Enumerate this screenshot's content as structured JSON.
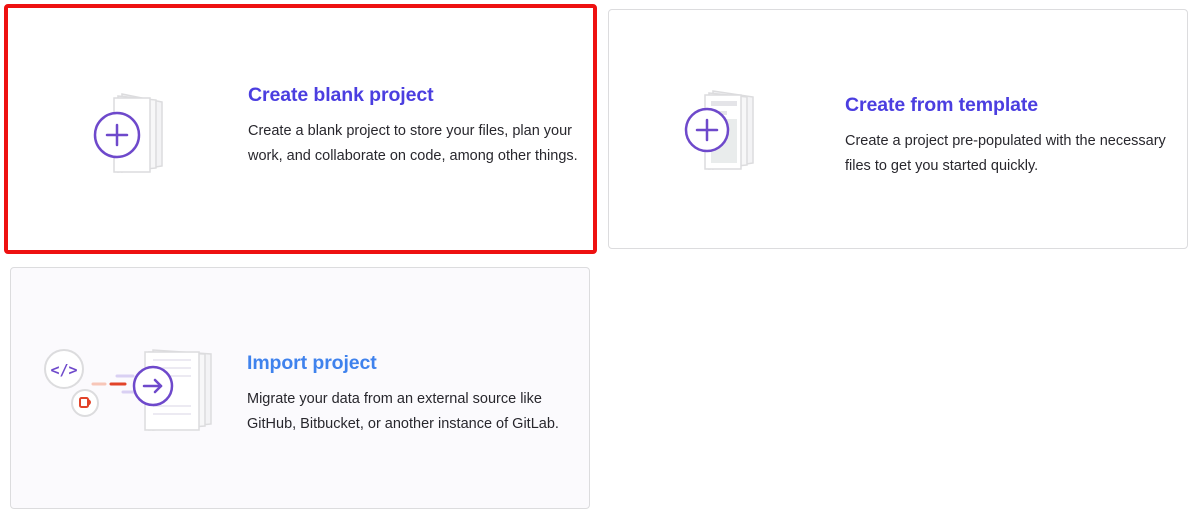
{
  "cards": {
    "blank": {
      "title": "Create blank project",
      "description": "Create a blank project to store your files, plan your work, and collaborate on code, among other things.",
      "icon": "new-project-plus-icon"
    },
    "template": {
      "title": "Create from template",
      "description": "Create a project pre-populated with the necessary files to get you started quickly.",
      "icon": "template-project-plus-icon"
    },
    "import": {
      "title": "Import project",
      "description": "Migrate your data from an external source like GitHub, Bitbucket, or another instance of GitLab.",
      "icon": "import-project-arrow-icon"
    }
  },
  "colors": {
    "primary_purple": "#4b3ee0",
    "import_blue": "#3f82ed",
    "selection_red": "#ee1111",
    "border_gray": "#dcdcde"
  }
}
